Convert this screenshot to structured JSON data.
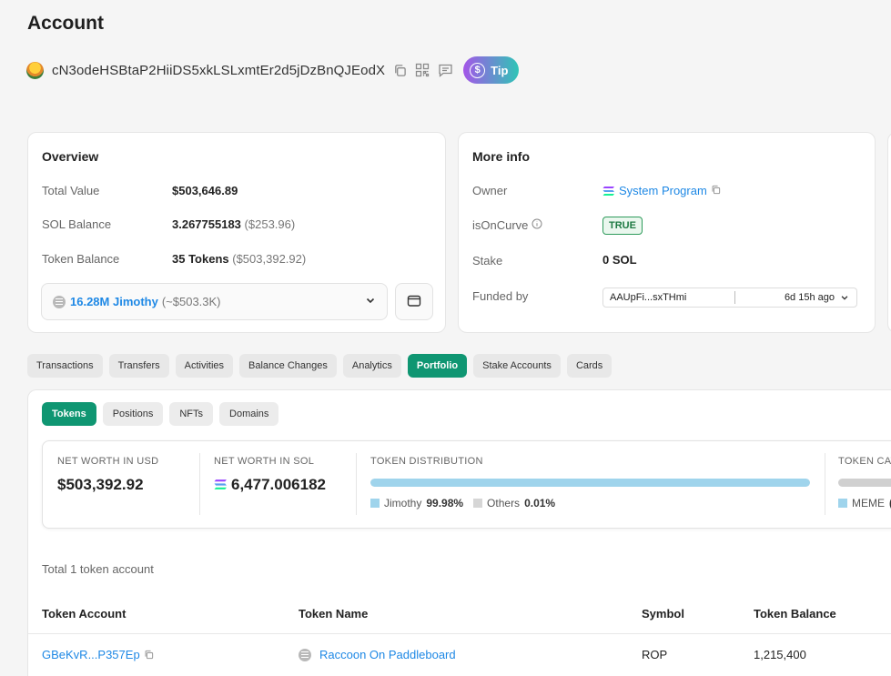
{
  "page": {
    "title": "Account"
  },
  "account": {
    "address": "cN3odeHSBtaP2HiiDS5xkLSLxmtEr2d5jDzBnQJEodX",
    "tip_label": "Tip",
    "tip_coin": "$"
  },
  "overview": {
    "title": "Overview",
    "rows": [
      {
        "label": "Total Value",
        "value": "$503,646.89",
        "sub": ""
      },
      {
        "label": "SOL Balance",
        "value": "3.267755183",
        "sub": "($253.96)"
      },
      {
        "label": "Token Balance",
        "value": "35 Tokens",
        "sub": "($503,392.92)"
      }
    ],
    "token_select": {
      "amount": "16.28M Jimothy",
      "approx": "(~$503.3K)"
    }
  },
  "more_info": {
    "title": "More info",
    "owner_label": "Owner",
    "owner_value": "System Program",
    "curve_label": "isOnCurve",
    "curve_value": "TRUE",
    "stake_label": "Stake",
    "stake_value": "0 SOL",
    "funded_label": "Funded by",
    "funded_addr": "AAUpFi...sxTHmi",
    "funded_time": "6d 15h ago"
  },
  "tabs": [
    "Transactions",
    "Transfers",
    "Activities",
    "Balance Changes",
    "Analytics",
    "Portfolio",
    "Stake Accounts",
    "Cards"
  ],
  "active_tab": "Portfolio",
  "subtabs": [
    "Tokens",
    "Positions",
    "NFTs",
    "Domains"
  ],
  "active_subtab": "Tokens",
  "stats": {
    "net_usd_label": "NET WORTH IN USD",
    "net_usd_value": "$503,392.92",
    "net_sol_label": "NET WORTH IN SOL",
    "net_sol_value": "6,477.006182",
    "dist_label": "TOKEN DISTRIBUTION",
    "dist_items": [
      {
        "name": "Jimothy",
        "pct": "99.98%",
        "fraction": 0.9998,
        "color": "#9fd4ec"
      },
      {
        "name": "Others",
        "pct": "0.01%",
        "fraction": 0.0001,
        "color": "#d6d6d6"
      }
    ],
    "cat_label": "TOKEN CATE",
    "cat_legend": "MEME",
    "cat_legend_suffix": "("
  },
  "table": {
    "total_text": "Total 1 token account",
    "headers": [
      "Token Account",
      "Token Name",
      "Symbol",
      "Token Balance"
    ],
    "rows": [
      {
        "account": "GBeKvR...P357Ep",
        "name": "Raccoon On Paddleboard",
        "symbol": "ROP",
        "balance": "1,215,400"
      }
    ]
  },
  "colors": {
    "accent": "#0f9672",
    "link": "#1e88e5",
    "bg": "#f5f5f5"
  }
}
